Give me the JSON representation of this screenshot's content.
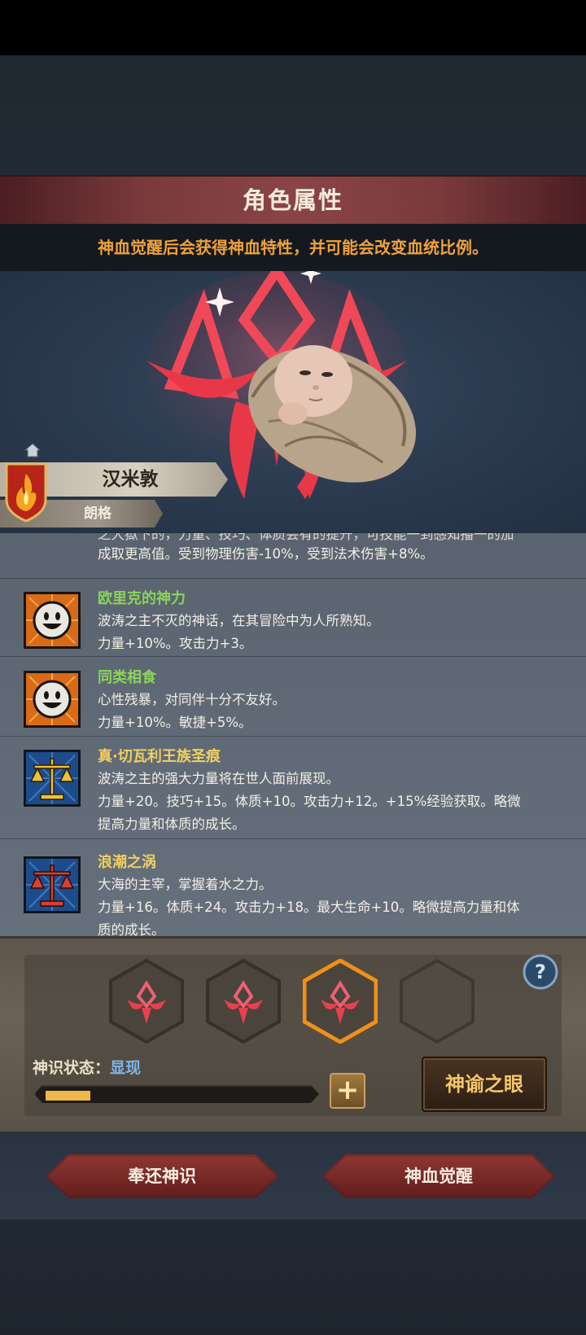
{
  "header": {
    "title": "角色属性",
    "subtitle": "神血觉醒后会获得神血特性，并可能会改变血统比例。"
  },
  "character": {
    "name": "汉米敦",
    "title": "朗格"
  },
  "traits": {
    "partial_line_1": "之大獄下的，力量、技巧、体质会有的提升，可技能一到感知播一的加",
    "partial_line_2": "成取更高值。受到物理伤害-10%，受到法术伤害+8%。",
    "items": [
      {
        "name": "欧里克的神力",
        "name_color": "#8ad45a",
        "icon": "smiley-face-icon",
        "lines": [
          "波涛之主不灭的神话，在其冒险中为人所熟知。",
          "力量+10%。攻击力+3。"
        ]
      },
      {
        "name": "同类相食",
        "name_color": "#8ad45a",
        "icon": "smiley-face-icon",
        "lines": [
          "心性残暴，对同伴十分不友好。",
          "力量+10%。敏捷+5%。"
        ]
      },
      {
        "name": "真·切瓦利王族圣痕",
        "name_color": "#f0d060",
        "icon": "gold-scales-icon",
        "lines": [
          "波涛之主的强大力量将在世人面前展现。",
          "力量+20。技巧+15。体质+10。攻击力+12。+15%经验获取。略微",
          "提高力量和体质的成长。"
        ]
      },
      {
        "name": "浪潮之涡",
        "name_color": "#f0d060",
        "icon": "red-scales-icon",
        "lines": [
          "大海的主宰，掌握着水之力。",
          "力量+16。体质+24。攻击力+18。最大生命+10。略微提高力量和体",
          "质的成长。"
        ]
      }
    ]
  },
  "divine": {
    "status_label": "神识状态：",
    "status_value": "显现",
    "progress": 0.17,
    "plus_label": "+",
    "oracle_label": "神谕之眼",
    "help_label": "?"
  },
  "actions": {
    "return_label": "奉还神识",
    "awaken_label": "神血觉醒"
  },
  "colors": {
    "accent_orange": "#f0a23a",
    "status_blue": "#7fb6ea",
    "crest_red": "#e8364a"
  }
}
